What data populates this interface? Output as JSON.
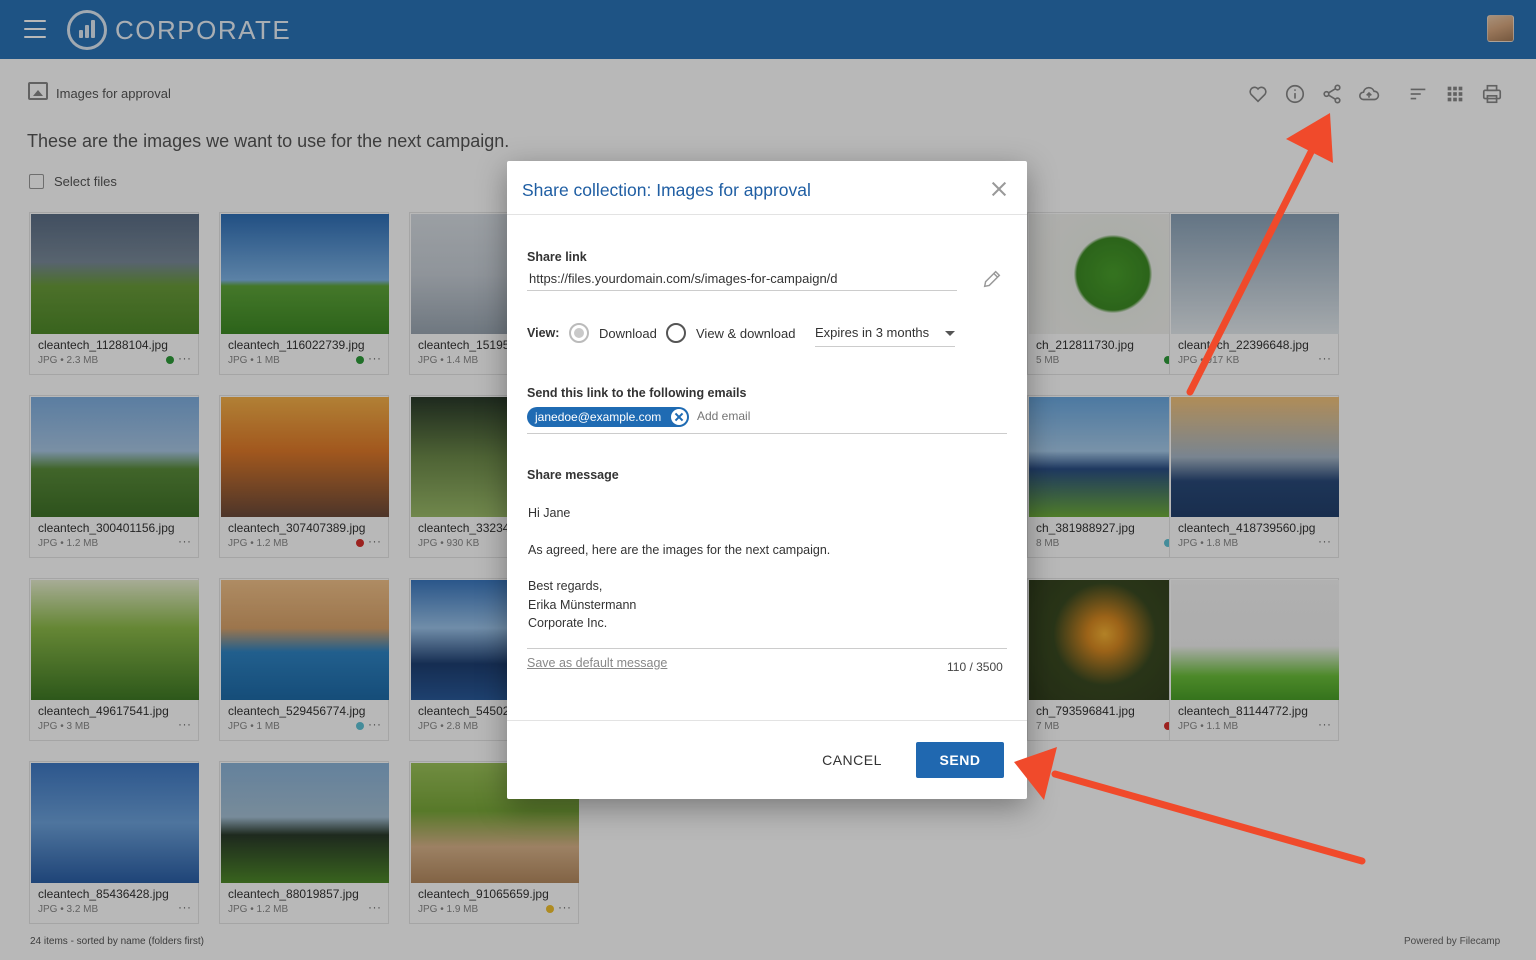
{
  "brand": {
    "name": "CORPORATE",
    "primary_color": "#2a73b8"
  },
  "collection": {
    "title": "Images for approval",
    "description": "These are the images we want to use for the next campaign.",
    "select_files_label": "Select files"
  },
  "toolbar": {
    "icons": [
      "heart-icon",
      "info-icon",
      "share-icon",
      "cloud-upload-icon",
      "sort-icon",
      "grid-icon",
      "print-icon"
    ]
  },
  "files": [
    {
      "name": "cleantech_11288104.jpg",
      "meta": "JPG • 2.3 MB",
      "status": "#2e9b3a"
    },
    {
      "name": "cleantech_116022739.jpg",
      "meta": "JPG • 1 MB",
      "status": "#2e9b3a"
    },
    {
      "name": "cleantech_15195",
      "meta": "JPG • 1.4 MB",
      "status": ""
    },
    {
      "name": "ch_212811730.jpg",
      "meta": "5 MB",
      "status": "#2e9b3a"
    },
    {
      "name": "cleantech_22396648.jpg",
      "meta": "JPG • 917 KB",
      "status": ""
    },
    {
      "name": "cleantech_300401156.jpg",
      "meta": "JPG • 1.2 MB",
      "status": ""
    },
    {
      "name": "cleantech_307407389.jpg",
      "meta": "JPG • 1.2 MB",
      "status": "#d9302c"
    },
    {
      "name": "cleantech_33234",
      "meta": "JPG • 930 KB",
      "status": ""
    },
    {
      "name": "ch_381988927.jpg",
      "meta": "8 MB",
      "status": "#5fc3d6"
    },
    {
      "name": "cleantech_418739560.jpg",
      "meta": "JPG • 1.8 MB",
      "status": ""
    },
    {
      "name": "cleantech_49617541.jpg",
      "meta": "JPG • 3 MB",
      "status": ""
    },
    {
      "name": "cleantech_529456774.jpg",
      "meta": "JPG • 1 MB",
      "status": "#5fc3d6"
    },
    {
      "name": "cleantech_54502",
      "meta": "JPG • 2.8 MB",
      "status": ""
    },
    {
      "name": "ch_793596841.jpg",
      "meta": "7 MB",
      "status": "#d9302c"
    },
    {
      "name": "cleantech_81144772.jpg",
      "meta": "JPG • 1.1 MB",
      "status": ""
    },
    {
      "name": "cleantech_85436428.jpg",
      "meta": "JPG • 3.2 MB",
      "status": ""
    },
    {
      "name": "cleantech_88019857.jpg",
      "meta": "JPG • 1.2 MB",
      "status": ""
    },
    {
      "name": "cleantech_91065659.jpg",
      "meta": "JPG • 1.9 MB",
      "status": "#f2c12e"
    }
  ],
  "footer": {
    "items_summary": "24 items - sorted by name (folders first)",
    "powered_by": "Powered by Filecamp"
  },
  "dialog": {
    "title": "Share collection: Images for approval",
    "share_link_label": "Share link",
    "share_link_value": "https://files.yourdomain.com/s/images-for-campaign/d",
    "view_label": "View:",
    "view_options": [
      "Download",
      "View & download"
    ],
    "view_selected": "Download",
    "expires_value": "Expires in 3 months",
    "emails_label": "Send this link to the following emails",
    "email_chip": "janedoe@example.com",
    "add_email_placeholder": "Add email",
    "message_label": "Share message",
    "message_lines": [
      "Hi Jane",
      "",
      "As agreed, here are the images for the next campaign.",
      "",
      "Best regards,",
      "Erika Münstermann",
      "Corporate Inc."
    ],
    "save_default_label": "Save as default message",
    "char_counter": "110 / 3500",
    "cancel_label": "CANCEL",
    "send_label": "SEND"
  },
  "annotation_color": "#f04a2b"
}
